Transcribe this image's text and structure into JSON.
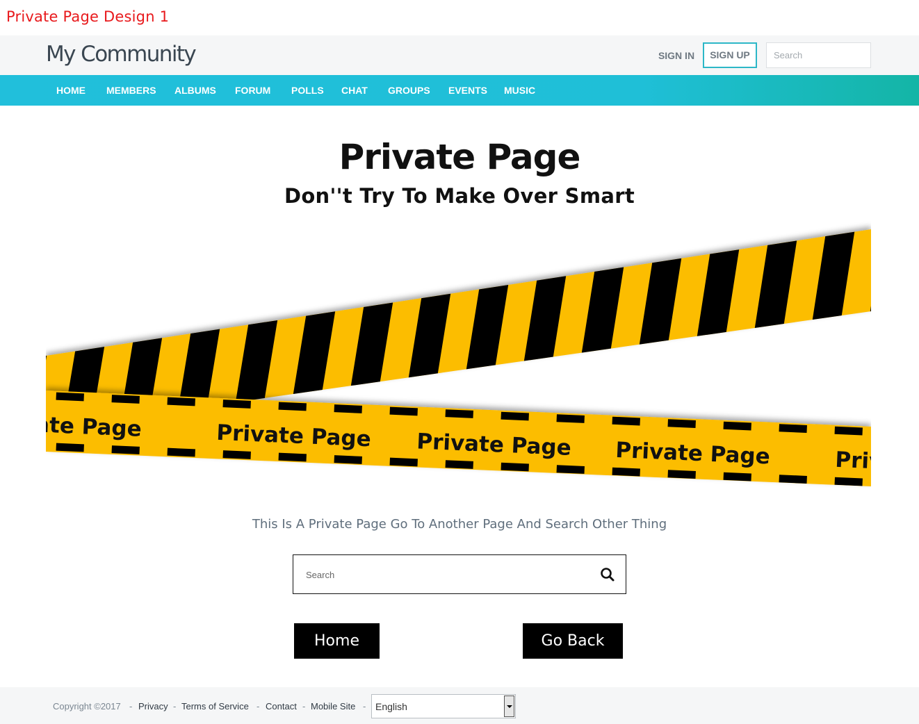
{
  "caption": "Private Page Design 1",
  "header": {
    "brand": "My Community",
    "sign_in": "SIGN IN",
    "sign_up": "SIGN UP",
    "search_placeholder": "Search"
  },
  "nav": {
    "items": [
      "HOME",
      "MEMBERS",
      "ALBUMS",
      "FORUM",
      "POLLS",
      "CHAT",
      "GROUPS",
      "EVENTS",
      "MUSIC"
    ]
  },
  "main": {
    "title": "Private Page",
    "subtitle": "Don''t Try To Make Over Smart",
    "tape_text": "Private Page",
    "message": "This Is A Private Page Go To Another Page And Search Other Thing",
    "search_placeholder": "Search",
    "home_button": "Home",
    "back_button": "Go Back"
  },
  "footer": {
    "copyright": "Copyright ©2017",
    "links": [
      "Privacy",
      "Terms of Service",
      "Contact",
      "Mobile Site"
    ],
    "separator": "-",
    "language": "English"
  },
  "colors": {
    "accent": "#21bfdb",
    "tape_yellow": "#fcbd02",
    "tape_black": "#000000",
    "caption_red": "#e8191c"
  },
  "icons": [
    "search-icon",
    "chevron-down-icon"
  ]
}
